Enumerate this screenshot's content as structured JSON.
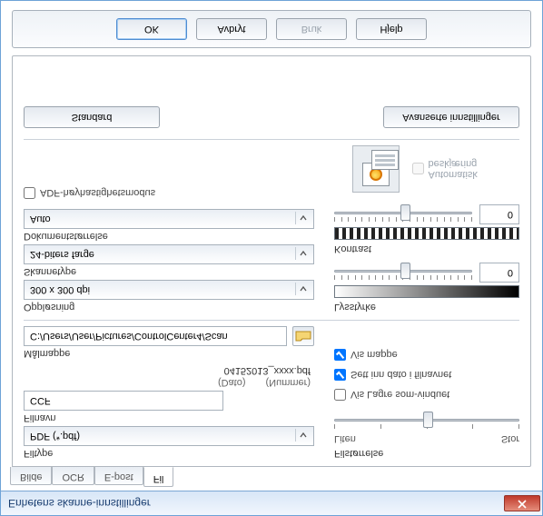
{
  "window": {
    "title": "Enhetens skanne-innstillinger"
  },
  "tabs": {
    "bilde": "Bilde",
    "ocr": "OCR",
    "epost": "E-post",
    "fil": "Fil"
  },
  "left": {
    "filtype_label": "Filtype",
    "filtype_value": "PDF (*.pdf)",
    "filnavn_label": "Filnavn",
    "filnavn_value": "CCF",
    "dato_header": "(Dato)",
    "nummer_header": "(Nummer)",
    "example_name": "04152013_xxxx.pdf",
    "malmappe_label": "Målmappe",
    "malmappe_value": "C:/Users/User/Pictures/ControlCenter4/Scan",
    "opplosning_label": "Oppløsning",
    "opplosning_value": "300 x 300 dpi",
    "skannetype_label": "Skannetype",
    "skannetype_value": "24-biters farge",
    "dokstor_label": "Dokumentstørrelse",
    "dokstor_value": "Auto",
    "adf_label": "ADF-høyhastighetsmodus"
  },
  "right": {
    "filesize_label": "Filstørrelse",
    "filesize_small": "Liten",
    "filesize_large": "Stor",
    "vis_lagre_label": "Vis Lagre som-vinduet",
    "sett_inn_dato_label": "Sett inn dato i filnavnet",
    "vis_mappe_label": "Vis mappe",
    "lysstyrke_label": "Lysstyrke",
    "lysstyrke_value": "0",
    "kontrast_label": "Kontrast",
    "kontrast_value": "0",
    "auto_crop_label": "Automatisk beskjæring"
  },
  "buttons": {
    "standard": "Standard",
    "avanserte": "Avanserte innstillinger",
    "ok": "OK",
    "avbryt": "Avbryt",
    "bruk": "Bruk",
    "hjelp": "Hjelp"
  }
}
